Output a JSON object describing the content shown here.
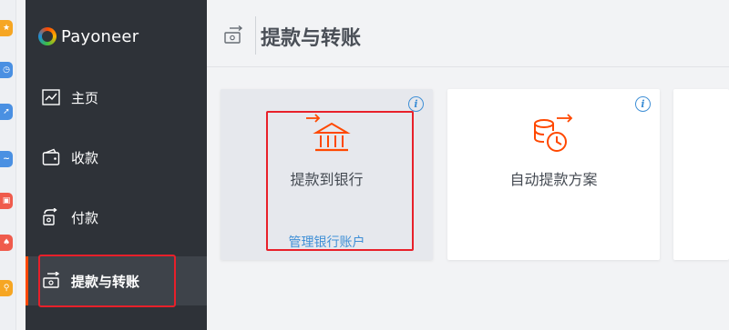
{
  "app": {
    "brand": "Payoneer",
    "accent_color": "#ff4800",
    "highlight_color": "#e8202a"
  },
  "extension_strip": [
    {
      "icon": "star-extension-icon",
      "color": "#f6a623"
    },
    {
      "icon": "clock-extension-icon",
      "color": "#4a90e2"
    },
    {
      "icon": "arrow-extension-icon",
      "color": "#4a90e2"
    },
    {
      "icon": "wave-extension-icon",
      "color": "#4a90e2"
    },
    {
      "icon": "pdf-extension-icon",
      "color": "#ef5b4c"
    },
    {
      "icon": "acrobat-extension-icon",
      "color": "#ef5b4c"
    },
    {
      "icon": "search-extension-icon",
      "color": "#f6a623"
    }
  ],
  "sidebar": {
    "items": [
      {
        "label": "主页",
        "icon": "chart-icon",
        "active": false
      },
      {
        "label": "收款",
        "icon": "wallet-icon",
        "active": false
      },
      {
        "label": "付款",
        "icon": "payment-icon",
        "active": false
      },
      {
        "label": "提款与转账",
        "icon": "transfer-icon",
        "active": true
      }
    ]
  },
  "header": {
    "title": "提款与转账",
    "icon": "transfer-icon"
  },
  "cards": [
    {
      "title": "提款到银行",
      "link": "管理银行账户",
      "icon": "bank-icon",
      "info": "i"
    },
    {
      "title": "自动提款方案",
      "icon": "coins-clock-icon",
      "info": "i"
    }
  ]
}
